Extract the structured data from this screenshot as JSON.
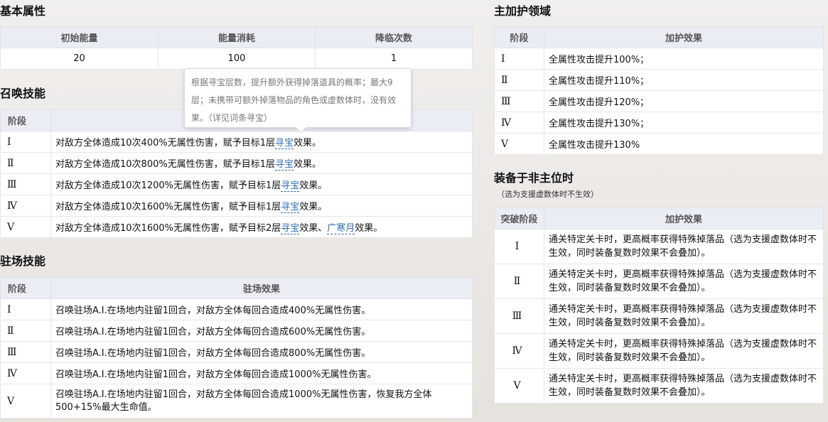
{
  "basic": {
    "title": "基本属性",
    "headers": [
      "初始能量",
      "能量消耗",
      "降临次数"
    ],
    "values": [
      "20",
      "100",
      "1"
    ]
  },
  "tooltip": {
    "text": "根据寻宝层数，提升额外获得掉落道具的概率；最大9层；未携带可额外掉落物品的角色或虚数体时，没有效果。（详见词条寻宝）"
  },
  "summon": {
    "title": "召唤技能",
    "header_stage": "阶段",
    "rows": [
      {
        "stage": "Ⅰ",
        "pre": "对敌方全体造成10次400%无属性伤害，赋予目标1层",
        "kw": "寻宝",
        "post": "效果。"
      },
      {
        "stage": "Ⅱ",
        "pre": "对敌方全体造成10次800%无属性伤害，赋予目标1层",
        "kw": "寻宝",
        "post": "效果。"
      },
      {
        "stage": "Ⅲ",
        "pre": "对敌方全体造成10次1200%无属性伤害，赋予目标1层",
        "kw": "寻宝",
        "post": "效果。"
      },
      {
        "stage": "Ⅳ",
        "pre": "对敌方全体造成10次1600%无属性伤害，赋予目标1层",
        "kw": "寻宝",
        "post": "效果。"
      },
      {
        "stage": "Ⅴ",
        "pre": "对敌方全体造成10次1600%无属性伤害，赋予目标2层",
        "kw": "寻宝",
        "mid": "效果、",
        "kw2": "广寒月",
        "post": "效果。"
      }
    ]
  },
  "station": {
    "title": "驻场技能",
    "header_stage": "阶段",
    "header_effect": "驻场效果",
    "rows": [
      {
        "stage": "Ⅰ",
        "text": "召唤驻场A.I.在场地内驻留1回合，对敌方全体每回合造成400%无属性伤害。"
      },
      {
        "stage": "Ⅱ",
        "text": "召唤驻场A.I.在场地内驻留1回合，对敌方全体每回合造成600%无属性伤害。"
      },
      {
        "stage": "Ⅲ",
        "text": "召唤驻场A.I.在场地内驻留1回合，对敌方全体每回合造成800%无属性伤害。"
      },
      {
        "stage": "Ⅳ",
        "text": "召唤驻场A.I.在场地内驻留1回合，对敌方全体每回合造成1000%无属性伤害。"
      },
      {
        "stage": "Ⅴ",
        "text": "召唤驻场A.I.在场地内驻留1回合，对敌方全体每回合造成1000%无属性伤害，恢复我方全体500+15%最大生命值。"
      }
    ]
  },
  "main_protect": {
    "title": "主加护领域",
    "header_stage": "阶段",
    "header_effect": "加护效果",
    "rows": [
      {
        "stage": "Ⅰ",
        "text": "全属性攻击提升100%；"
      },
      {
        "stage": "Ⅱ",
        "text": "全属性攻击提升110%；"
      },
      {
        "stage": "Ⅲ",
        "text": "全属性攻击提升120%；"
      },
      {
        "stage": "Ⅳ",
        "text": "全属性攻击提升130%；"
      },
      {
        "stage": "Ⅴ",
        "text": "全属性攻击提升130%"
      }
    ]
  },
  "non_main": {
    "title": "装备于非主位时",
    "note": "（选为支援虚数体时不生效）",
    "header_stage": "突破阶段",
    "header_effect": "加护效果",
    "rows": [
      {
        "stage": "Ⅰ",
        "text": "通关特定关卡时，更高概率获得特殊掉落品（选为支援虚数体时不生效，同时装备复数时效果不会叠加）。"
      },
      {
        "stage": "Ⅱ",
        "text": "通关特定关卡时，更高概率获得特殊掉落品（选为支援虚数体时不生效，同时装备复数时效果不会叠加）。"
      },
      {
        "stage": "Ⅲ",
        "text": "通关特定关卡时，更高概率获得特殊掉落品（选为支援虚数体时不生效，同时装备复数时效果不会叠加）。"
      },
      {
        "stage": "Ⅳ",
        "text": "通关特定关卡时，更高概率获得特殊掉落品（选为支援虚数体时不生效，同时装备复数时效果不会叠加）。"
      },
      {
        "stage": "Ⅴ",
        "text": "通关特定关卡时，更高概率获得特殊掉落品（选为支援虚数体时不生效，同时装备复数时效果不会叠加）。"
      }
    ]
  }
}
